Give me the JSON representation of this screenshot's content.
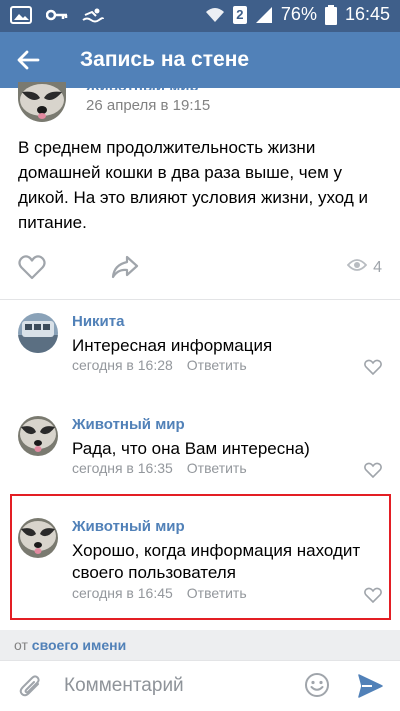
{
  "status_bar": {
    "battery_percent": "76%",
    "time": "16:45",
    "sim_label": "2",
    "bg_color": "#3f5f8a"
  },
  "app_bar": {
    "title": "Запись на стене",
    "back_icon": "arrow-left-icon",
    "bg_color": "#5181b8"
  },
  "post": {
    "author": "Животный мир",
    "date": "26 апреля в 19:15",
    "text": "В среднем продолжительность жизни домашней кошки в два раза выше, чем у дикой. На это влияют условия жизни, уход и питание.",
    "views": "4"
  },
  "comments": [
    {
      "author": "Никита",
      "text": "Интересная информация",
      "time": "сегодня в 16:28",
      "reply_label": "Ответить"
    },
    {
      "author": "Животный мир",
      "text": "Рада, что она Вам интересна)",
      "time": "сегодня в 16:35",
      "reply_label": "Ответить"
    },
    {
      "author": "Животный мир",
      "text": "Хорошо, когда информация находит своего пользователя",
      "time": "сегодня в 16:45",
      "reply_label": "Ответить"
    }
  ],
  "footer": {
    "from_prefix": "от",
    "from_link": "своего имени",
    "input_placeholder": "Комментарий"
  },
  "colors": {
    "accent": "#5181b8",
    "highlight_border": "#e31e24"
  }
}
